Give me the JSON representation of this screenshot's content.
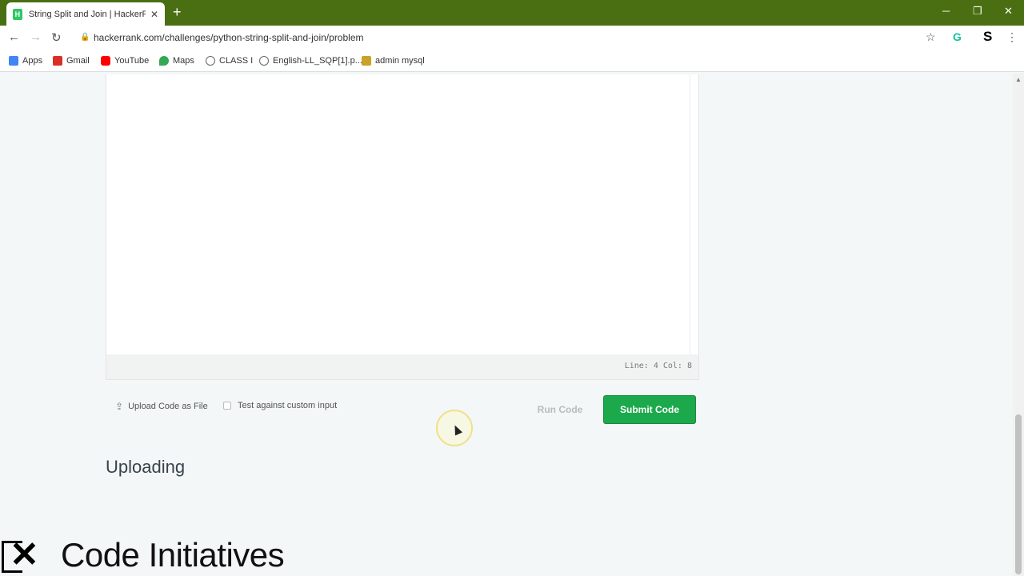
{
  "browser": {
    "tab_title": "String Split and Join | HackerRank",
    "favicon_label": "H",
    "url": "hackerrank.com/challenges/python-string-split-and-join/problem",
    "profile_letter": "S"
  },
  "bookmarks": [
    {
      "label": "Apps",
      "icon": "apps-grid-icon",
      "color": "#4285f4"
    },
    {
      "label": "Gmail",
      "icon": "gmail-icon",
      "color": "#d93025"
    },
    {
      "label": "YouTube",
      "icon": "youtube-icon",
      "color": "#ff0000"
    },
    {
      "label": "Maps",
      "icon": "maps-pin-icon",
      "color": "#34a853"
    },
    {
      "label": "CLASS I",
      "icon": "globe-icon",
      "color": "#666666"
    },
    {
      "label": "English-LL_SQP[1].p...",
      "icon": "globe-icon",
      "color": "#666666"
    },
    {
      "label": "admin mysql",
      "icon": "folder-icon",
      "color": "#c9a227"
    }
  ],
  "editor": {
    "status": "Line: 4 Col: 8"
  },
  "actions": {
    "upload_label": "Upload Code as File",
    "custom_input_label": "Test against custom input",
    "run_label": "Run Code",
    "submit_label": "Submit Code"
  },
  "section": {
    "heading": "Uploading"
  },
  "watermark": {
    "text": "Code Initiatives"
  },
  "colors": {
    "titlebar": "#4a6f12",
    "submit": "#1ba94c",
    "heading": "#39424e"
  }
}
